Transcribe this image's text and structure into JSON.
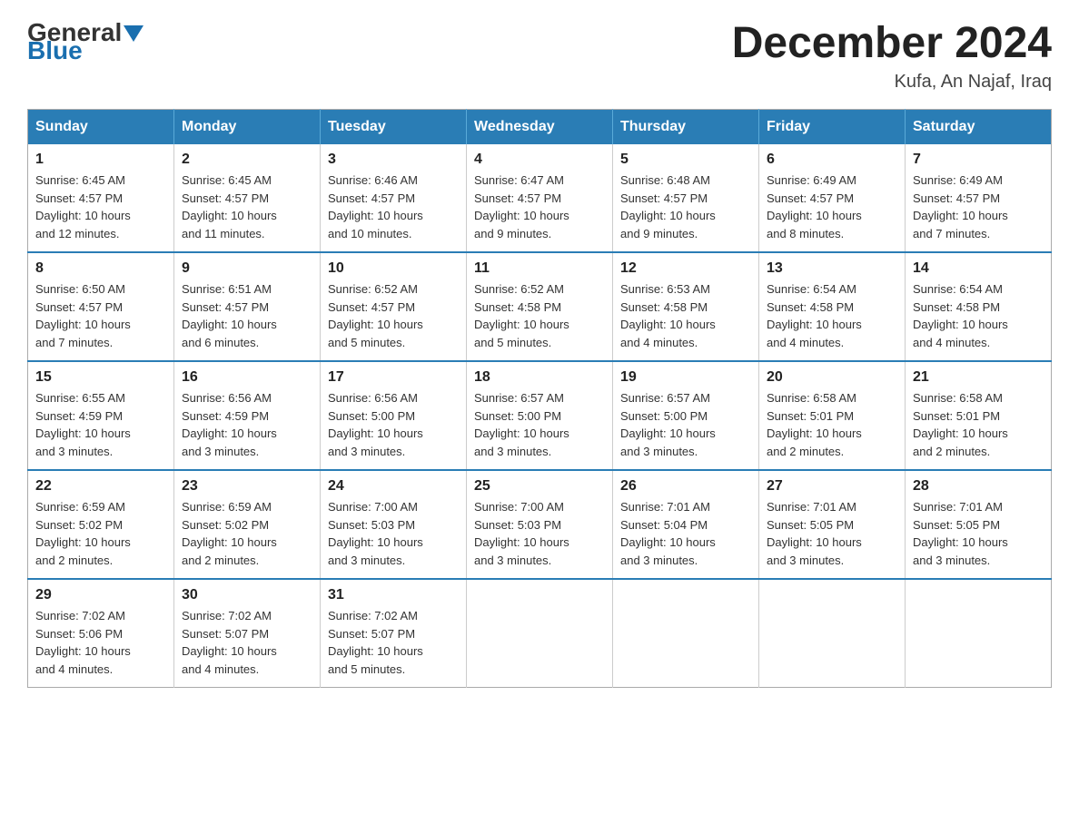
{
  "header": {
    "logo_general": "General",
    "logo_blue": "Blue",
    "month_title": "December 2024",
    "location": "Kufa, An Najaf, Iraq"
  },
  "weekdays": [
    "Sunday",
    "Monday",
    "Tuesday",
    "Wednesday",
    "Thursday",
    "Friday",
    "Saturday"
  ],
  "weeks": [
    [
      {
        "day": "1",
        "sunrise": "6:45 AM",
        "sunset": "4:57 PM",
        "daylight": "10 hours and 12 minutes."
      },
      {
        "day": "2",
        "sunrise": "6:45 AM",
        "sunset": "4:57 PM",
        "daylight": "10 hours and 11 minutes."
      },
      {
        "day": "3",
        "sunrise": "6:46 AM",
        "sunset": "4:57 PM",
        "daylight": "10 hours and 10 minutes."
      },
      {
        "day": "4",
        "sunrise": "6:47 AM",
        "sunset": "4:57 PM",
        "daylight": "10 hours and 9 minutes."
      },
      {
        "day": "5",
        "sunrise": "6:48 AM",
        "sunset": "4:57 PM",
        "daylight": "10 hours and 9 minutes."
      },
      {
        "day": "6",
        "sunrise": "6:49 AM",
        "sunset": "4:57 PM",
        "daylight": "10 hours and 8 minutes."
      },
      {
        "day": "7",
        "sunrise": "6:49 AM",
        "sunset": "4:57 PM",
        "daylight": "10 hours and 7 minutes."
      }
    ],
    [
      {
        "day": "8",
        "sunrise": "6:50 AM",
        "sunset": "4:57 PM",
        "daylight": "10 hours and 7 minutes."
      },
      {
        "day": "9",
        "sunrise": "6:51 AM",
        "sunset": "4:57 PM",
        "daylight": "10 hours and 6 minutes."
      },
      {
        "day": "10",
        "sunrise": "6:52 AM",
        "sunset": "4:57 PM",
        "daylight": "10 hours and 5 minutes."
      },
      {
        "day": "11",
        "sunrise": "6:52 AM",
        "sunset": "4:58 PM",
        "daylight": "10 hours and 5 minutes."
      },
      {
        "day": "12",
        "sunrise": "6:53 AM",
        "sunset": "4:58 PM",
        "daylight": "10 hours and 4 minutes."
      },
      {
        "day": "13",
        "sunrise": "6:54 AM",
        "sunset": "4:58 PM",
        "daylight": "10 hours and 4 minutes."
      },
      {
        "day": "14",
        "sunrise": "6:54 AM",
        "sunset": "4:58 PM",
        "daylight": "10 hours and 4 minutes."
      }
    ],
    [
      {
        "day": "15",
        "sunrise": "6:55 AM",
        "sunset": "4:59 PM",
        "daylight": "10 hours and 3 minutes."
      },
      {
        "day": "16",
        "sunrise": "6:56 AM",
        "sunset": "4:59 PM",
        "daylight": "10 hours and 3 minutes."
      },
      {
        "day": "17",
        "sunrise": "6:56 AM",
        "sunset": "5:00 PM",
        "daylight": "10 hours and 3 minutes."
      },
      {
        "day": "18",
        "sunrise": "6:57 AM",
        "sunset": "5:00 PM",
        "daylight": "10 hours and 3 minutes."
      },
      {
        "day": "19",
        "sunrise": "6:57 AM",
        "sunset": "5:00 PM",
        "daylight": "10 hours and 3 minutes."
      },
      {
        "day": "20",
        "sunrise": "6:58 AM",
        "sunset": "5:01 PM",
        "daylight": "10 hours and 2 minutes."
      },
      {
        "day": "21",
        "sunrise": "6:58 AM",
        "sunset": "5:01 PM",
        "daylight": "10 hours and 2 minutes."
      }
    ],
    [
      {
        "day": "22",
        "sunrise": "6:59 AM",
        "sunset": "5:02 PM",
        "daylight": "10 hours and 2 minutes."
      },
      {
        "day": "23",
        "sunrise": "6:59 AM",
        "sunset": "5:02 PM",
        "daylight": "10 hours and 2 minutes."
      },
      {
        "day": "24",
        "sunrise": "7:00 AM",
        "sunset": "5:03 PM",
        "daylight": "10 hours and 3 minutes."
      },
      {
        "day": "25",
        "sunrise": "7:00 AM",
        "sunset": "5:03 PM",
        "daylight": "10 hours and 3 minutes."
      },
      {
        "day": "26",
        "sunrise": "7:01 AM",
        "sunset": "5:04 PM",
        "daylight": "10 hours and 3 minutes."
      },
      {
        "day": "27",
        "sunrise": "7:01 AM",
        "sunset": "5:05 PM",
        "daylight": "10 hours and 3 minutes."
      },
      {
        "day": "28",
        "sunrise": "7:01 AM",
        "sunset": "5:05 PM",
        "daylight": "10 hours and 3 minutes."
      }
    ],
    [
      {
        "day": "29",
        "sunrise": "7:02 AM",
        "sunset": "5:06 PM",
        "daylight": "10 hours and 4 minutes."
      },
      {
        "day": "30",
        "sunrise": "7:02 AM",
        "sunset": "5:07 PM",
        "daylight": "10 hours and 4 minutes."
      },
      {
        "day": "31",
        "sunrise": "7:02 AM",
        "sunset": "5:07 PM",
        "daylight": "10 hours and 5 minutes."
      },
      null,
      null,
      null,
      null
    ]
  ],
  "labels": {
    "sunrise": "Sunrise:",
    "sunset": "Sunset:",
    "daylight": "Daylight:"
  }
}
